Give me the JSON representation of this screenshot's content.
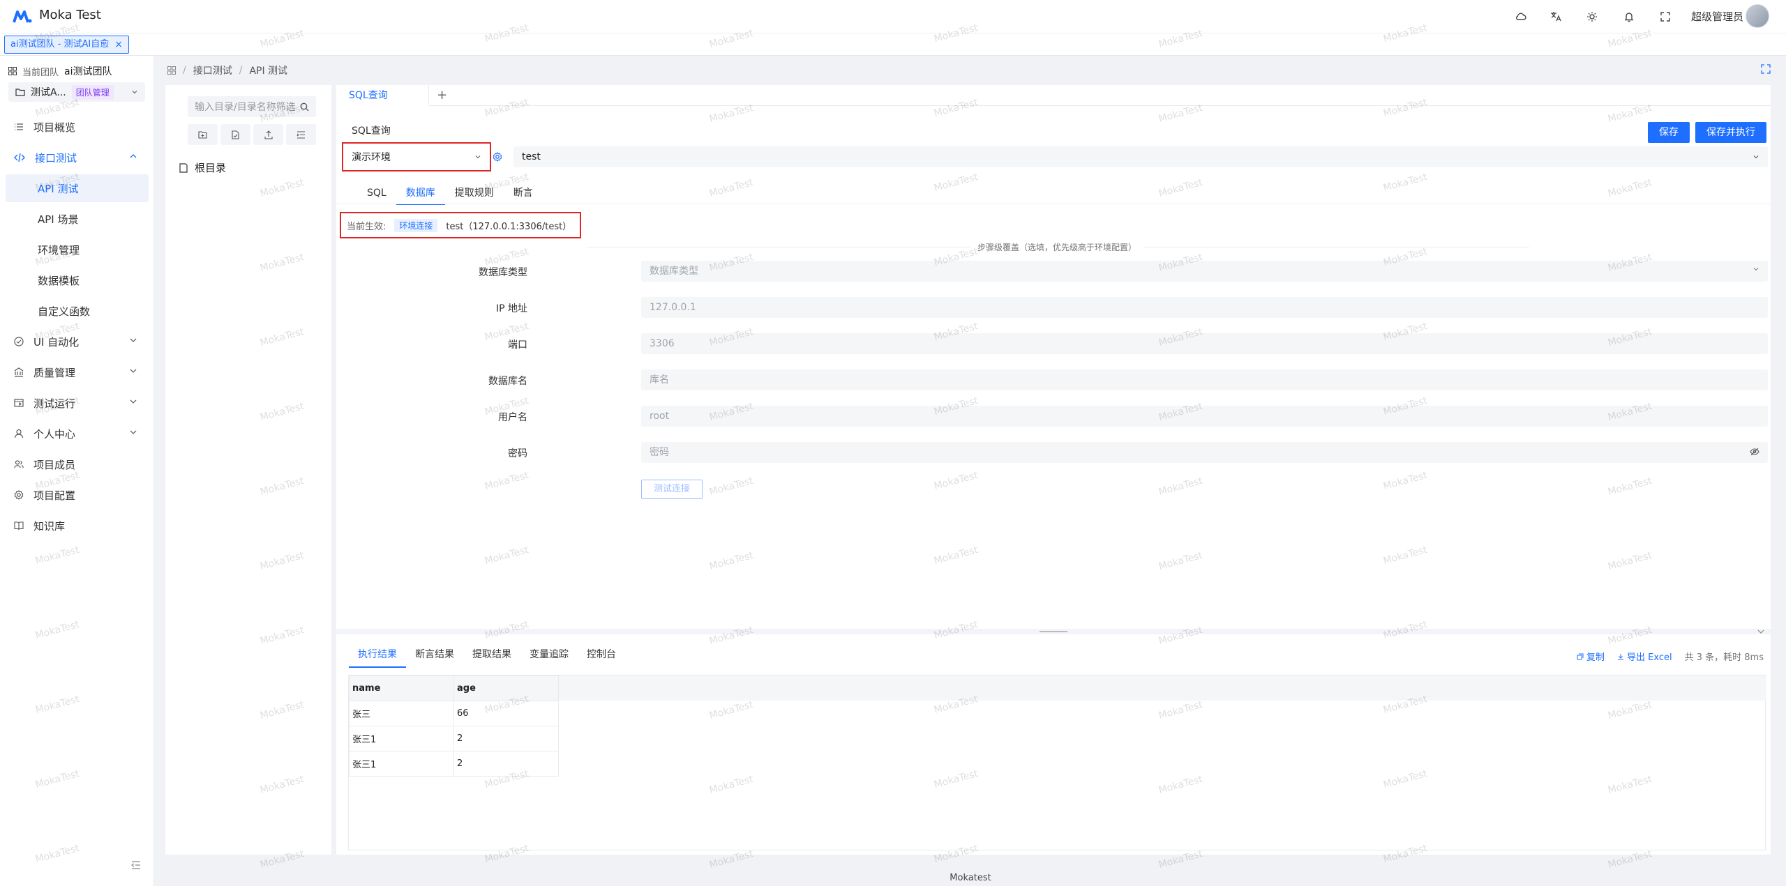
{
  "app": {
    "title": "Moka Test"
  },
  "header": {
    "user_name": "超级管理员",
    "icons": [
      "cloud-icon",
      "translate-icon",
      "theme-sun-icon",
      "bell-icon",
      "fullscreen-icon"
    ]
  },
  "tabbar": {
    "tab_label": "ai测试团队 - 测试AI自愈",
    "close": "×"
  },
  "sidebar": {
    "team_label": "当前团队",
    "team_name": "ai测试团队",
    "project_name": "测试A...",
    "project_badge": "团队管理",
    "items": [
      {
        "label": "项目概览",
        "icon": "list-icon"
      },
      {
        "label": "接口测试",
        "icon": "code-icon",
        "expanded": true
      },
      {
        "label": "UI 自动化",
        "icon": "check-circle-icon"
      },
      {
        "label": "质量管理",
        "icon": "bank-icon"
      },
      {
        "label": "测试运行",
        "icon": "run-icon"
      },
      {
        "label": "个人中心",
        "icon": "user-icon"
      },
      {
        "label": "项目成员",
        "icon": "users-icon"
      },
      {
        "label": "项目配置",
        "icon": "gear-icon"
      },
      {
        "label": "知识库",
        "icon": "book-icon"
      }
    ],
    "sub_items": [
      {
        "label": "API 测试",
        "selected": true
      },
      {
        "label": "API 场景"
      },
      {
        "label": "环境管理"
      },
      {
        "label": "数据模板"
      },
      {
        "label": "自定义函数"
      }
    ]
  },
  "breadcrumb": {
    "items": [
      "接口测试",
      "API 测试"
    ],
    "sep": "/"
  },
  "tree": {
    "search_placeholder": "输入目录/目录名称筛选",
    "root_label": "根目录"
  },
  "editor": {
    "tab_label": "SQL查询",
    "add_tab": "+",
    "section_title": "SQL查询",
    "save_label": "保存",
    "save_run_label": "保存并执行",
    "env_value": "演示环境",
    "db_value": "test",
    "sub_tabs": [
      "SQL",
      "数据库",
      "提取规则",
      "断言"
    ],
    "active_sub_tab": "数据库",
    "current_label": "当前生效:",
    "current_chip": "环境连接",
    "current_value": "test（127.0.0.1:3306/test）",
    "override_text": "步骤级覆盖（选填，优先级高于环境配置）",
    "form": [
      {
        "label": "数据库类型",
        "value": "数据库类型"
      },
      {
        "label": "IP 地址",
        "value": "127.0.0.1"
      },
      {
        "label": "端口",
        "value": "3306"
      },
      {
        "label": "数据库名",
        "value": "库名"
      },
      {
        "label": "用户名",
        "value": "root"
      },
      {
        "label": "密码",
        "value": "密码"
      }
    ],
    "test_conn_label": "测试连接"
  },
  "result": {
    "tabs": [
      "执行结果",
      "断言结果",
      "提取结果",
      "变量追踪",
      "控制台"
    ],
    "copy_label": "复制",
    "export_label": "导出 Excel",
    "stat": "共 3 条，耗时 8ms",
    "columns": [
      "name",
      "age"
    ],
    "rows": [
      [
        "张三",
        "66"
      ],
      [
        "张三1",
        "2"
      ],
      [
        "张三1",
        "2"
      ]
    ]
  },
  "footer": {
    "text": "Mokatest"
  },
  "watermark": {
    "text": "MokaTest"
  },
  "colors": {
    "primary": "#1e6fff",
    "highlight_border": "#e02424",
    "badge_purple": "#7c3aed"
  }
}
